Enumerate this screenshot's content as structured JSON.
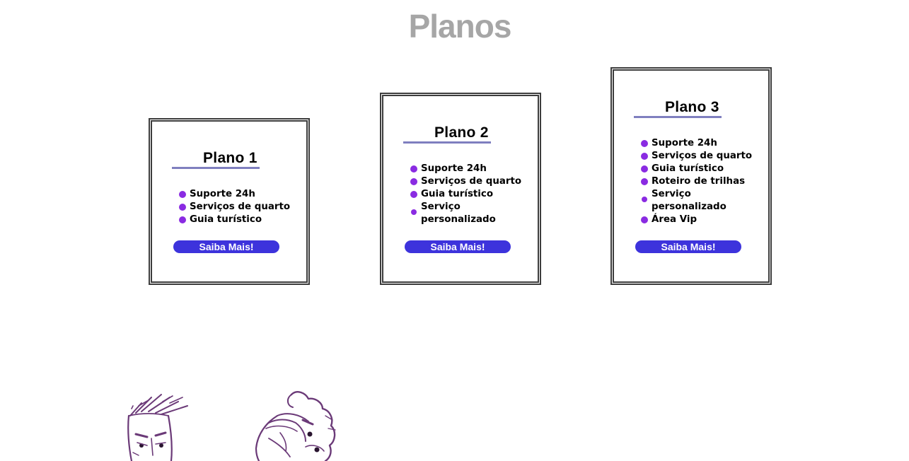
{
  "page": {
    "title": "Planos"
  },
  "plans": [
    {
      "title": "Plano 1",
      "features": [
        "Suporte 24h",
        "Serviços de quarto",
        "Guia turístico"
      ],
      "button_label": "Saiba Mais!"
    },
    {
      "title": "Plano 2",
      "features": [
        "Suporte 24h",
        "Serviços de quarto",
        "Guia turístico",
        "Serviço personalizado"
      ],
      "button_label": "Saiba Mais!"
    },
    {
      "title": "Plano 3",
      "features": [
        "Suporte 24h",
        "Serviços de quarto",
        "Guia turístico",
        "Roteiro de trilhas",
        "Serviço personalizado",
        "Área Vip"
      ],
      "button_label": "Saiba Mais!"
    }
  ],
  "colors": {
    "title_gray": "#a6a6a6",
    "bullet_purple": "#8a2be2",
    "button_blue": "#3d33dc",
    "underline_lavender": "#7f7fbf",
    "border_dark": "#3d3d3d"
  },
  "illustration": {
    "icon": "sketch-characters-illustration"
  }
}
